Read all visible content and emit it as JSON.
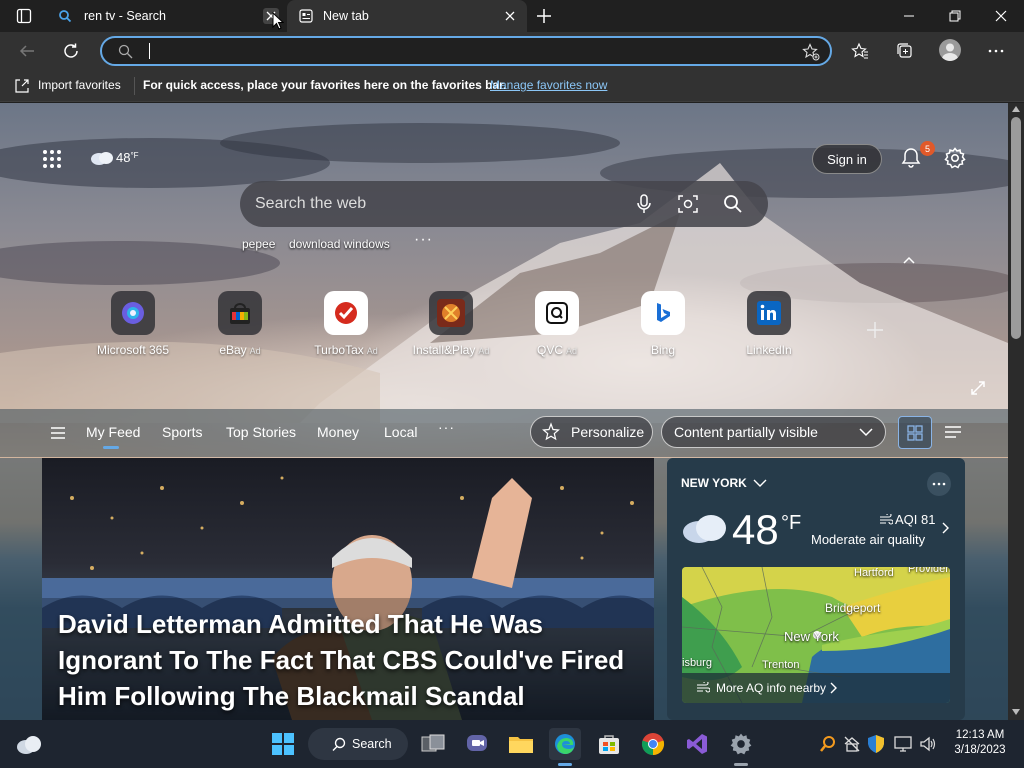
{
  "tabs": [
    {
      "title": "ren tv - Search"
    },
    {
      "title": "New tab"
    }
  ],
  "favorites_bar": {
    "import_label": "Import favorites",
    "message": "For quick access, place your favorites here on the favorites bar.",
    "manage_link": "Manage favorites now"
  },
  "header": {
    "temperature": "48",
    "temp_unit": "°F",
    "sign_in": "Sign in",
    "notif_count": "5"
  },
  "search": {
    "placeholder": "Search the web",
    "suggestions": [
      "pepee",
      "download windows"
    ]
  },
  "quick_links": [
    {
      "label": "Microsoft 365",
      "ad": ""
    },
    {
      "label": "eBay",
      "ad": "Ad"
    },
    {
      "label": "TurboTax",
      "ad": "Ad"
    },
    {
      "label": "Install&Play",
      "ad": "Ad"
    },
    {
      "label": "QVC",
      "ad": "Ad"
    },
    {
      "label": "Bing",
      "ad": ""
    },
    {
      "label": "LinkedIn",
      "ad": ""
    }
  ],
  "feed_nav": {
    "items": [
      "My Feed",
      "Sports",
      "Top Stories",
      "Money",
      "Local"
    ],
    "active": "My Feed",
    "personalize": "Personalize",
    "content_visibility": "Content partially visible"
  },
  "hero": {
    "headline": "David Letterman Admitted That He Was Ignorant To The Fact That CBS Could've Fired Him Following The Blackmail Scandal"
  },
  "weather": {
    "location": "NEW YORK",
    "temperature": "48",
    "unit": "°F",
    "aqi": "AQI 81",
    "aqi_desc": "Moderate air quality",
    "map_labels": [
      "Hartford",
      "Providen",
      "Bridgeport",
      "New York",
      "Trenton",
      "isburg"
    ],
    "more_link": "More AQ info nearby"
  },
  "taskbar": {
    "search_label": "Search",
    "time": "12:13 AM",
    "date": "3/18/2023"
  },
  "colors": {
    "accent": "#65a9e6",
    "link": "#8bc6f6",
    "notif_badge": "#e0592a"
  }
}
